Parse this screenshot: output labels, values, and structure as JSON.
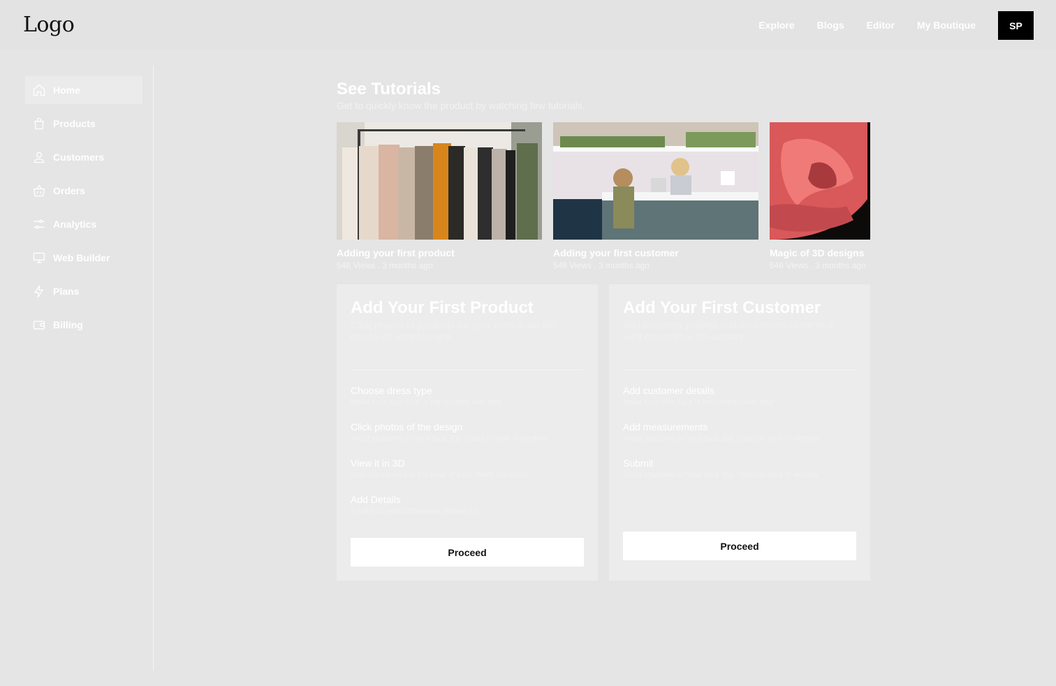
{
  "header": {
    "logo": "Logo",
    "nav": [
      "Explore",
      "Blogs",
      "Editor",
      "My Boutique"
    ],
    "avatar": "SP"
  },
  "sidebar": {
    "items": [
      {
        "label": "Home",
        "icon": "home-icon"
      },
      {
        "label": "Products",
        "icon": "bag-icon"
      },
      {
        "label": "Customers",
        "icon": "user-icon"
      },
      {
        "label": "Orders",
        "icon": "basket-icon"
      },
      {
        "label": "Analytics",
        "icon": "sliders-icon"
      },
      {
        "label": "Web Builder",
        "icon": "monitor-icon"
      },
      {
        "label": "Plans",
        "icon": "lightning-icon"
      },
      {
        "label": "Billing",
        "icon": "wallet-icon"
      }
    ]
  },
  "tutorials": {
    "title": "See Tutorials",
    "subtitle": "Get to quickly know the product by watching few tutorials.",
    "items": [
      {
        "title": "Adding your first product",
        "meta": "546 Views . 3 months ago"
      },
      {
        "title": "Adding your first customer",
        "meta": "546 Views . 3 months ago"
      },
      {
        "title": "Magic of 3D designs",
        "meta": "546 Views . 3 months ago"
      }
    ]
  },
  "product_card": {
    "title": "Add Your First Product",
    "description": "Click photos of products for your store & we will create 3D versions of it.",
    "steps": [
      {
        "title": "Choose dress type",
        "desc": "Make sure your face is not covered with hair"
      },
      {
        "title": "Click photos of the design",
        "desc": "Avoid shadows on your face. Eg. Stand in front of window"
      },
      {
        "title": "View it in 3D",
        "desc": "Hold the camera at the level of your chest, not lower"
      },
      {
        "title": "Add Details",
        "desc": "It will look weird otherwise, believe us"
      }
    ],
    "button": "Proceed"
  },
  "customer_card": {
    "title": "Add Your First Customer",
    "description": "Add customer profiles and their measurements & we'll create their 3D avatars.",
    "steps": [
      {
        "title": "Add customer details",
        "desc": "Make sure your face is not covered with hair"
      },
      {
        "title": "Add measurements",
        "desc": "Avoid shadows on your face. Eg. Stand in front of window"
      },
      {
        "title": "Submit",
        "desc": "Avoid shadows on your face. Eg. Stand in front of window"
      }
    ],
    "button": "Proceed"
  }
}
